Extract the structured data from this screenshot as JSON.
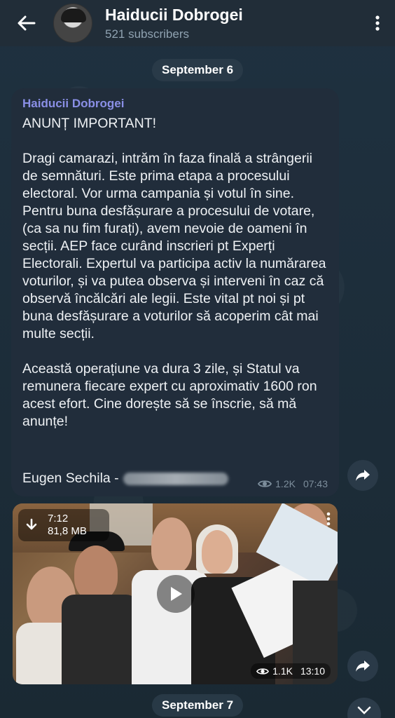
{
  "header": {
    "title": "Haiducii Dobrogei",
    "subtitle": "521 subscribers"
  },
  "dates": {
    "first": "September 6",
    "second": "September 7"
  },
  "message": {
    "author": "Haiducii Dobrogei",
    "text": "ANUNȚ IMPORTANT!\n\nDragi camarazi, intrăm în faza finală a strângerii de semnături. Este prima etapa a procesului electoral. Vor urma campania și votul în sine.\nPentru buna desfășurare a procesului de votare, (ca sa nu fim furați), avem nevoie de oameni în secții. AEP face curând inscrieri pt Experți Electorali. Expertul va participa activ la numărarea voturilor, și va putea observa și interveni în caz că observă încălcări ale legii. Este vital pt noi și pt buna desfășurare a voturilor să acoperim cât mai multe secții.\n\nAceastă operațiune va dura 3 zile, și Statul va remunera fiecare expert cu aproximativ 1600 ron acest efort. Cine dorește să se înscrie, să mă anunțe!",
    "signature": "Eugen Sechila -",
    "views": "1.2K",
    "time": "07:43"
  },
  "video": {
    "duration": "7:12",
    "size": "81,8 MB",
    "views": "1.1K",
    "time": "13:10"
  },
  "icons": {
    "back": "back-arrow-icon",
    "menu": "more-vertical-icon",
    "share": "share-forward-icon",
    "download": "download-icon",
    "play": "play-icon",
    "eye": "eye-icon",
    "scroll": "chevron-down-icon"
  },
  "colors": {
    "header_bg": "#212d38",
    "bubble_bg": "#212d3b",
    "author": "#8a8fe6",
    "meta": "#7d8e9c"
  }
}
